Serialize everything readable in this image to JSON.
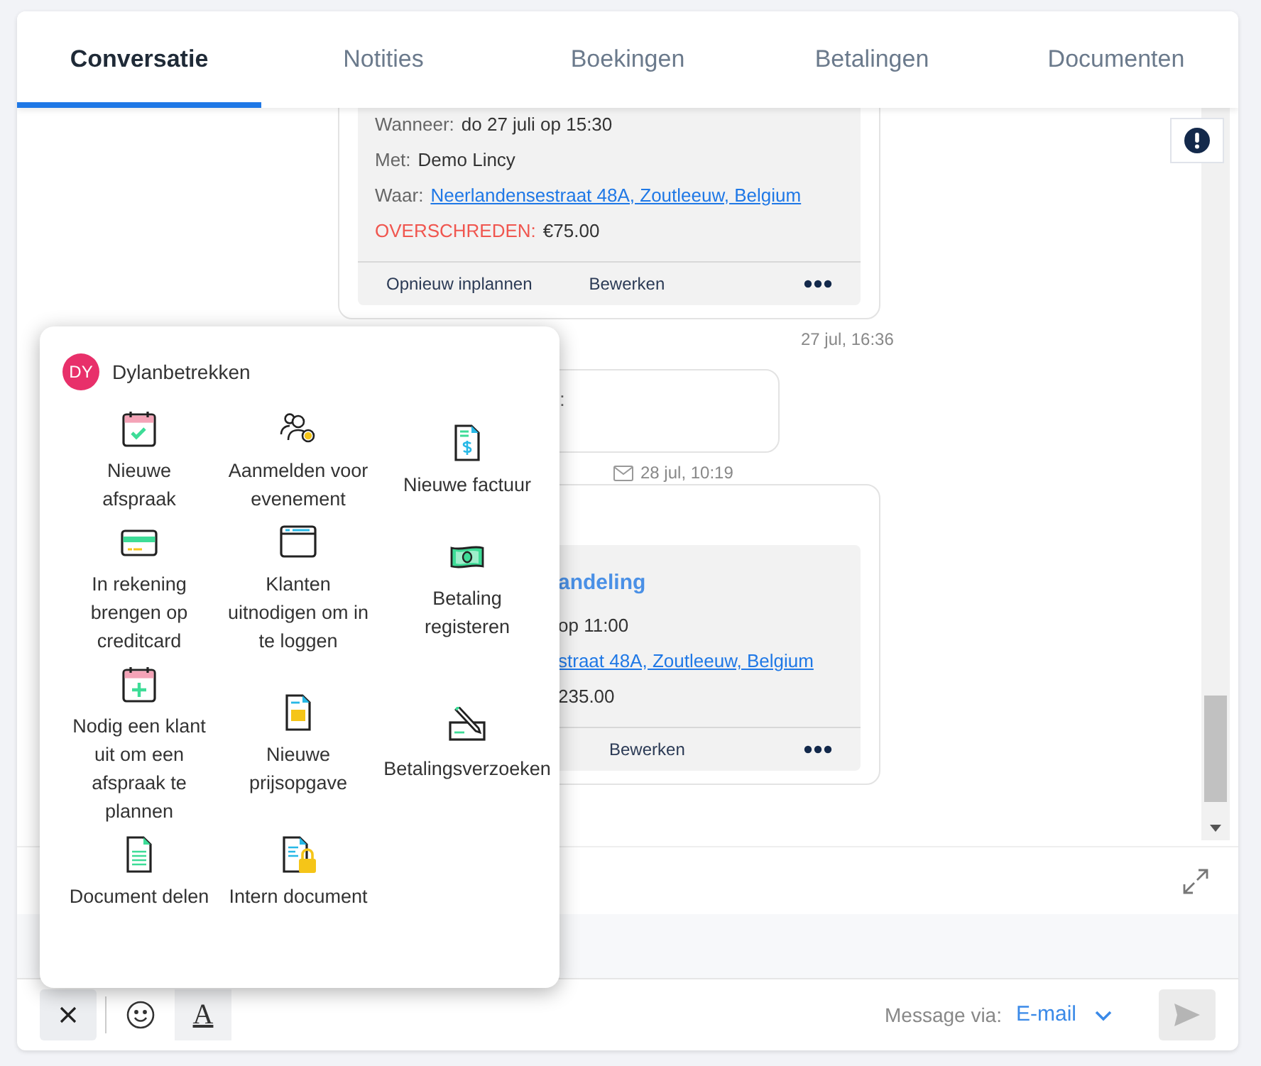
{
  "tabs": [
    {
      "label": "Conversatie",
      "selected": true
    },
    {
      "label": "Notities",
      "selected": false
    },
    {
      "label": "Boekingen",
      "selected": false
    },
    {
      "label": "Betalingen",
      "selected": false
    },
    {
      "label": "Documenten",
      "selected": false
    }
  ],
  "messages": [
    {
      "kind": "appointment",
      "fields": [
        {
          "kind": "text",
          "label": "Wanneer:",
          "value": "do 27 juli op 15:30"
        },
        {
          "kind": "text",
          "label": "Met:",
          "value": "Demo Lincy"
        },
        {
          "kind": "link",
          "label": "Waar:",
          "value": "Neerlandensestraat 48A, Zoutleeuw, Belgium"
        },
        {
          "kind": "overdue",
          "label": "OVERSCHREDEN:",
          "value": "€75.00"
        }
      ],
      "actions": [
        "Opnieuw inplannen",
        "Bewerken"
      ],
      "time": "27 jul, 16:36"
    },
    {
      "kind": "email",
      "text": ":",
      "time": "28 jul, 10:19"
    },
    {
      "kind": "appointment",
      "title": "andeling",
      "fields": [
        {
          "kind": "text",
          "value": "op 11:00"
        },
        {
          "kind": "link",
          "value": "straat 48A, Zoutleeuw, Belgium"
        },
        {
          "kind": "text",
          "value": "235.00"
        }
      ],
      "actions": [
        "Bewerken"
      ]
    }
  ],
  "popup": {
    "avatar": "DY",
    "name": "Dylanbetrekken",
    "items": [
      {
        "label": "Nieuwe afspraak"
      },
      {
        "label": "Aanmelden voor evenement"
      },
      {
        "label": "Nieuwe factuur"
      },
      {
        "label": "In rekening brengen op creditcard"
      },
      {
        "label": "Klanten uitnodigen om in te loggen"
      },
      {
        "label": "Betaling registeren"
      },
      {
        "label": "Nodig een klant uit om een afspraak te plannen"
      },
      {
        "label": "Nieuwe prijsopgave"
      },
      {
        "label": "Betalingsverzoeken"
      },
      {
        "label": "Document delen"
      },
      {
        "label": "Intern document"
      }
    ]
  },
  "composer": {
    "format_label": "A",
    "via_label": "Message via:",
    "via_value": "E-mail"
  }
}
